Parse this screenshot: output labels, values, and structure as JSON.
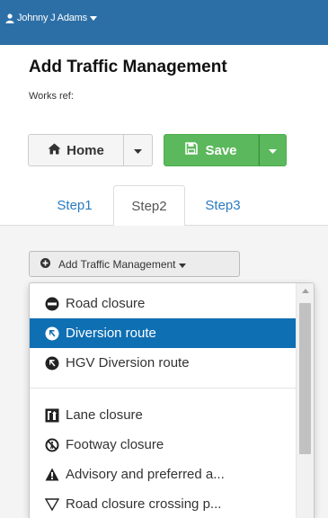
{
  "header": {
    "user_name": "Johnny J Adams"
  },
  "page": {
    "title": "Add Traffic Management",
    "works_ref_label": "Works ref:"
  },
  "toolbar": {
    "home_label": "Home",
    "save_label": "Save"
  },
  "tabs": [
    {
      "label": "Step1",
      "active": false
    },
    {
      "label": "Step2",
      "active": true
    },
    {
      "label": "Step3",
      "active": false
    }
  ],
  "add_menu": {
    "button_label": "Add Traffic Management",
    "items": [
      {
        "label": "Road closure",
        "icon": "no-entry-icon",
        "selected": false
      },
      {
        "label": "Diversion route",
        "icon": "diversion-arrow-icon",
        "selected": true
      },
      {
        "label": "HGV Diversion route",
        "icon": "diversion-arrow-icon",
        "selected": false
      },
      {
        "label": "Lane closure",
        "icon": "lane-closure-icon",
        "selected": false
      },
      {
        "label": "Footway closure",
        "icon": "pedestrian-prohibited-icon",
        "selected": false
      },
      {
        "label": "Advisory and preferred a...",
        "icon": "warning-triangle-icon",
        "selected": false
      },
      {
        "label": "Road closure crossing p...",
        "icon": "triangle-outline-icon",
        "selected": false
      }
    ]
  },
  "colors": {
    "header_bg": "#2c6fa6",
    "link": "#2b7bbf",
    "save_green": "#5cb85c",
    "selected_bg": "#0f6fb3"
  }
}
